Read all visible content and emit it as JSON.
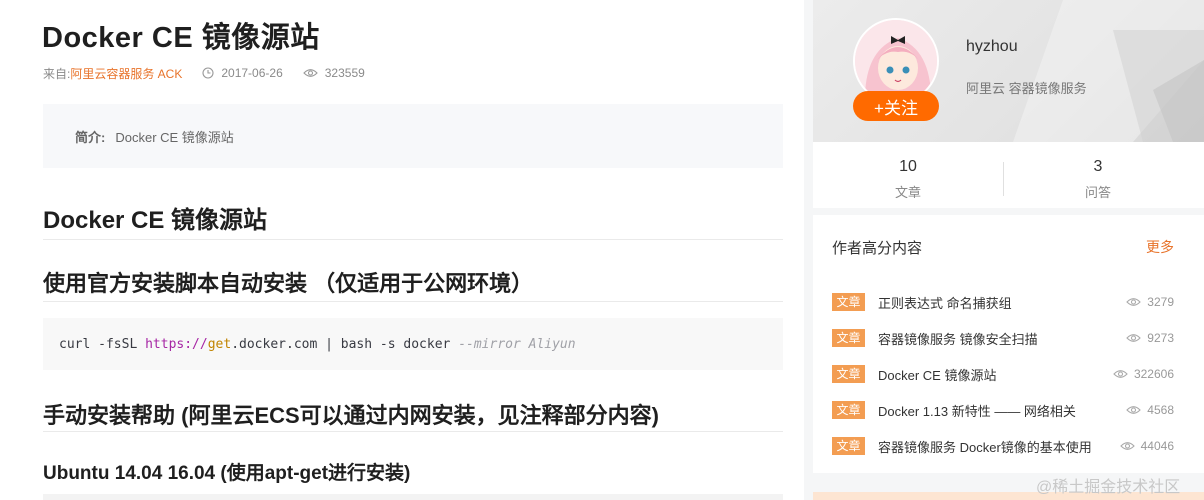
{
  "article": {
    "title": "Docker CE 镜像源站",
    "meta": {
      "source_prefix": "来自:",
      "source": "阿里云容器服务 ACK",
      "date": "2017-06-26",
      "views": "323559"
    },
    "summary": {
      "label": "简介:",
      "text": "Docker CE 镜像源站"
    },
    "h2": "Docker CE 镜像源站",
    "h3_install": "使用官方安装脚本自动安装 （仅适用于公网环境）",
    "code": {
      "cmd": "curl -fsSL ",
      "url_prefix": "https://",
      "url_kw": "get",
      "url_rest": ".docker.com | bash -s docker ",
      "comment": "--mirror Aliyun"
    },
    "h3_manual": "手动安装帮助 (阿里云ECS可以通过内网安装，见注释部分内容)",
    "h4_ubuntu": "Ubuntu 14.04 16.04 (使用apt-get进行安装)"
  },
  "profile": {
    "username": "hyzhou",
    "description": "阿里云 容器镜像服务",
    "follow_label": "+关注",
    "stats": [
      {
        "num": "10",
        "label": "文章"
      },
      {
        "num": "3",
        "label": "问答"
      }
    ]
  },
  "hot": {
    "title": "作者高分内容",
    "more": "更多",
    "items": [
      {
        "tag": "文章",
        "title": "正则表达式 命名捕获组",
        "views": "3279"
      },
      {
        "tag": "文章",
        "title": "容器镜像服务 镜像安全扫描",
        "views": "9273"
      },
      {
        "tag": "文章",
        "title": "Docker CE 镜像源站",
        "views": "322606"
      },
      {
        "tag": "文章",
        "title": "Docker 1.13 新特性 —— 网络相关",
        "views": "4568"
      },
      {
        "tag": "文章",
        "title": "容器镜像服务 Docker镜像的基本使用",
        "views": "44046"
      }
    ]
  },
  "watermark": "@稀土掘金技术社区",
  "colors": {
    "accent": "#e8732a",
    "follow": "#ff6a00",
    "tag": "#f39d52"
  }
}
